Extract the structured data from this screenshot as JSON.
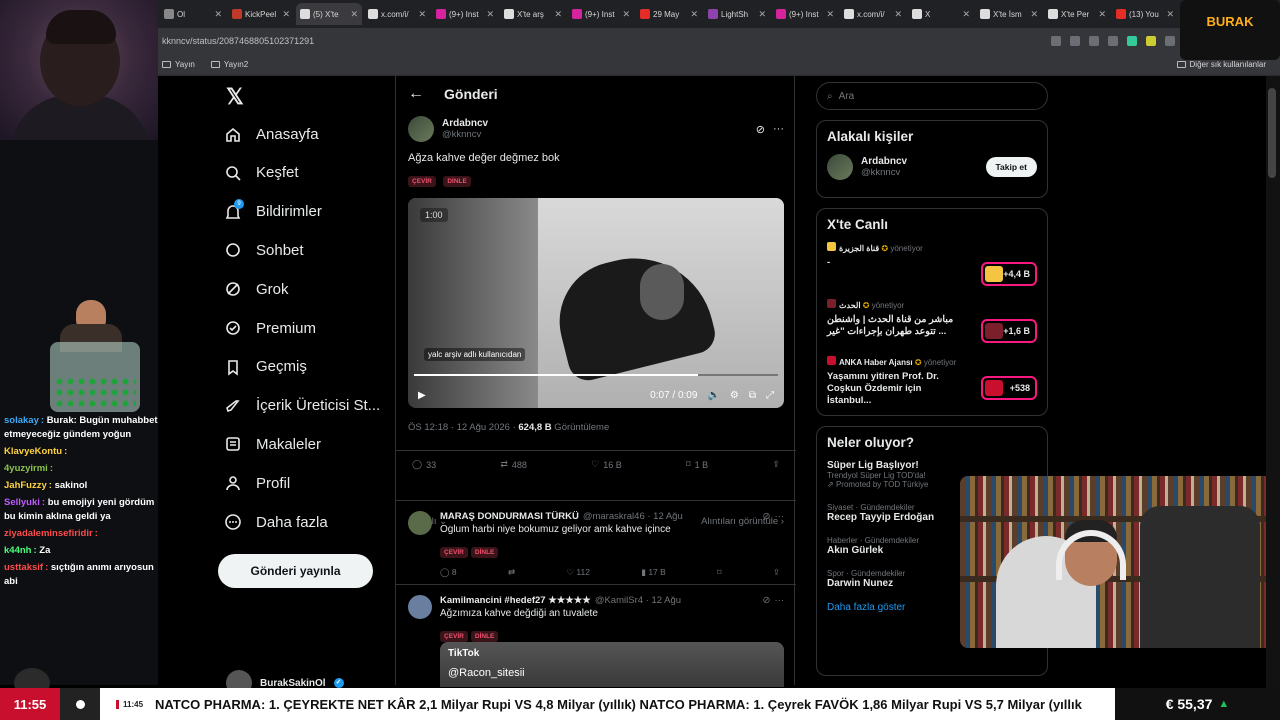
{
  "browser": {
    "tabs": [
      {
        "label": "Ol",
        "color": "#888888"
      },
      {
        "label": "KickPeel",
        "color": "#c0392b"
      },
      {
        "label": "(5) X'te",
        "color": "#dddddd",
        "active": true
      },
      {
        "label": "x.com/i/",
        "color": "#dddddd"
      },
      {
        "label": "(9+) Inst",
        "color": "#d6249f"
      },
      {
        "label": "X'te arş",
        "color": "#dddddd"
      },
      {
        "label": "(9+) Inst",
        "color": "#d6249f"
      },
      {
        "label": "29 May",
        "color": "#e52d27"
      },
      {
        "label": "LightSh",
        "color": "#8e44ad"
      },
      {
        "label": "(9+) Inst",
        "color": "#d6249f"
      },
      {
        "label": "x.com/i/",
        "color": "#dddddd"
      },
      {
        "label": "X",
        "color": "#dddddd"
      },
      {
        "label": "X'te İsm",
        "color": "#dddddd"
      },
      {
        "label": "X'te Per",
        "color": "#dddddd"
      },
      {
        "label": "(13) You",
        "color": "#e52d27"
      }
    ],
    "url": "kknncv/status/2087468805102371291",
    "bookmarks": [
      "Yayın",
      "Yayın2"
    ],
    "other_bookmarks": "Diğer sık kullanılanlar"
  },
  "stream": {
    "logo_text": "BURAK",
    "chat": [
      {
        "user": "solakay",
        "msg": "Burak: Bugün muhabbet etmeyeceğiz gündem yoğun",
        "color": "#3fa9f5"
      },
      {
        "user": "KlavyeKontu",
        "msg": "",
        "color": "#ffd23f"
      },
      {
        "user": "4yuzyirmi",
        "msg": "",
        "color": "#8bc34a"
      },
      {
        "user": "JahFuzzy",
        "msg": "sakinol",
        "color": "#ffd23f"
      },
      {
        "user": "Sellyuki",
        "msg": "bu emojiyi yeni gördüm bu kimin aklına geldi ya",
        "color": "#c05cff"
      },
      {
        "user": "ziyadaleminsefiridir",
        "msg": "",
        "color": "#ff4b4b"
      },
      {
        "user": "k44nh",
        "msg": "Za",
        "color": "#4bff7a"
      },
      {
        "user": "usttaksif",
        "msg": "sıçtığın anımı arıyosun abi",
        "color": "#ff4b4b"
      }
    ],
    "ticker": {
      "clock": "11:55",
      "time": "11:45",
      "text": "NATCO PHARMA: 1. ÇEYREKTE NET KÂR 2,1 Milyar Rupi VS 4,8 Milyar (yıllık) NATCO PHARMA: 1. Çeyrek FAVÖK 1,86 Milyar Rupi VS 5,7 Milyar (yıllık",
      "eur": "€ 55,37"
    }
  },
  "nav": {
    "items": [
      {
        "label": "Anasayfa",
        "icon": "home-icon"
      },
      {
        "label": "Keşfet",
        "icon": "search-icon"
      },
      {
        "label": "Bildirimler",
        "icon": "bell-icon"
      },
      {
        "label": "Sohbet",
        "icon": "chat-icon"
      },
      {
        "label": "Grok",
        "icon": "grok-icon"
      },
      {
        "label": "Premium",
        "icon": "premium-icon"
      },
      {
        "label": "Geçmiş",
        "icon": "bookmark-icon"
      },
      {
        "label": "İçerik Üreticisi St...",
        "icon": "rocket-icon"
      },
      {
        "label": "Makaleler",
        "icon": "article-icon"
      },
      {
        "label": "Profil",
        "icon": "person-icon"
      },
      {
        "label": "Daha fazla",
        "icon": "more-icon"
      }
    ],
    "post_button": "Gönderi yayınla",
    "account": "BurakSakinOl",
    "notif_count": "9"
  },
  "main": {
    "header": "Gönderi",
    "post": {
      "name": "Ardabncv",
      "handle": "@kknncv",
      "text": "Ağza kahve değer değmez bok",
      "chips": [
        "ÇEVİR",
        "DİNLE"
      ],
      "video_start": "1:00",
      "watermark": "yalc arşiv adlı kullanıcıdan",
      "video_time": "0:07 / 0:09",
      "video_progress": 0.78,
      "meta_time": "ÖS 12:18 · 12 Ağu 2026 · ",
      "views": "624,8 B",
      "views_label": " Görüntüleme",
      "replies": "33",
      "reposts": "488",
      "likes": "16 B",
      "bookmarks": "1 B",
      "sort": "Alakalı",
      "quotes": "Alıntıları görüntüle"
    },
    "replies": [
      {
        "name": "MARAŞ DONDURMASI TÜRKÜ",
        "handle": "@maraskral46 · 12 Ağu",
        "text": "Oglum harbi niye bokumuz geliyor amk kahve içince",
        "replies": "8",
        "likes": "112",
        "views": "17 B"
      },
      {
        "name": "Kamilmancini #hedef27 ★★★★★",
        "handle": "@KamilSr4 · 12 Ağu",
        "text": "Ağzımıza kahve değdiği an tuvalete",
        "tiktok_label": "TikTok",
        "tiktok_user": "@Racon_sitesii"
      }
    ]
  },
  "right": {
    "search_placeholder": "Ara",
    "related_title": "Alakalı kişiler",
    "related": {
      "name": "Ardabncv",
      "handle": "@kknncv",
      "button": "Takip et"
    },
    "live_title": "X'te Canlı",
    "live": [
      {
        "source": "قناة الجزيرة",
        "status": "yönetiyor",
        "title": "-",
        "count": "+4,4 B"
      },
      {
        "source": "الحدث",
        "status": "yönetiyor",
        "title": "مباشر من قناة الحدث | واشنطن تتوعد طهران بإجراءات \"غير ...",
        "count": "+1,6 B"
      },
      {
        "source": "ANKA Haber Ajansı",
        "status": "yönetiyor",
        "title": "Yaşamını yitiren Prof. Dr. Coşkun Özdemir için İstanbul...",
        "count": "+538"
      }
    ],
    "trends_title": "Neler oluyor?",
    "trends": [
      {
        "category": "",
        "title": "Süper Lig Başlıyor!",
        "sub": "Trendyol Süper Lig TOD'da!",
        "promo": "Promoted by TOD Türkiye"
      },
      {
        "category": "Siyaset · Gündemdekiler",
        "title": "Recep Tayyip Erdoğan"
      },
      {
        "category": "Haberler · Gündemdekiler",
        "title": "Akın Gürlek"
      },
      {
        "category": "Spor · Gündemdekiler",
        "title": "Darwin Nunez"
      }
    ],
    "show_more": "Daha fazla göster"
  }
}
